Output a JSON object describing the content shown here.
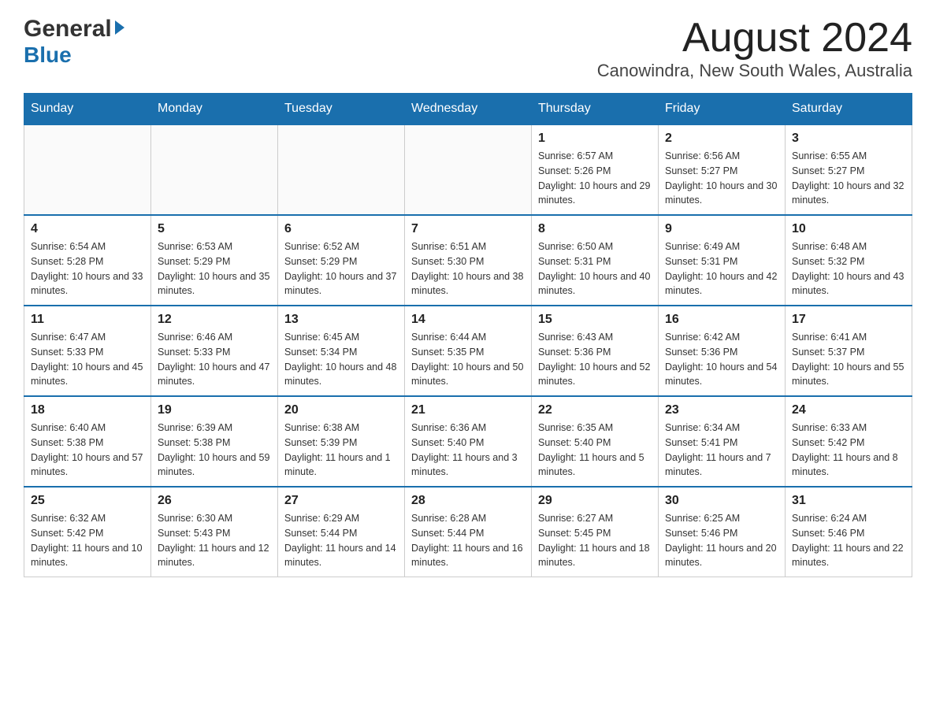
{
  "header": {
    "logo_general": "General",
    "logo_blue": "Blue",
    "month": "August 2024",
    "location": "Canowindra, New South Wales, Australia"
  },
  "days_of_week": [
    "Sunday",
    "Monday",
    "Tuesday",
    "Wednesday",
    "Thursday",
    "Friday",
    "Saturday"
  ],
  "weeks": [
    [
      {
        "day": "",
        "info": ""
      },
      {
        "day": "",
        "info": ""
      },
      {
        "day": "",
        "info": ""
      },
      {
        "day": "",
        "info": ""
      },
      {
        "day": "1",
        "info": "Sunrise: 6:57 AM\nSunset: 5:26 PM\nDaylight: 10 hours and 29 minutes."
      },
      {
        "day": "2",
        "info": "Sunrise: 6:56 AM\nSunset: 5:27 PM\nDaylight: 10 hours and 30 minutes."
      },
      {
        "day": "3",
        "info": "Sunrise: 6:55 AM\nSunset: 5:27 PM\nDaylight: 10 hours and 32 minutes."
      }
    ],
    [
      {
        "day": "4",
        "info": "Sunrise: 6:54 AM\nSunset: 5:28 PM\nDaylight: 10 hours and 33 minutes."
      },
      {
        "day": "5",
        "info": "Sunrise: 6:53 AM\nSunset: 5:29 PM\nDaylight: 10 hours and 35 minutes."
      },
      {
        "day": "6",
        "info": "Sunrise: 6:52 AM\nSunset: 5:29 PM\nDaylight: 10 hours and 37 minutes."
      },
      {
        "day": "7",
        "info": "Sunrise: 6:51 AM\nSunset: 5:30 PM\nDaylight: 10 hours and 38 minutes."
      },
      {
        "day": "8",
        "info": "Sunrise: 6:50 AM\nSunset: 5:31 PM\nDaylight: 10 hours and 40 minutes."
      },
      {
        "day": "9",
        "info": "Sunrise: 6:49 AM\nSunset: 5:31 PM\nDaylight: 10 hours and 42 minutes."
      },
      {
        "day": "10",
        "info": "Sunrise: 6:48 AM\nSunset: 5:32 PM\nDaylight: 10 hours and 43 minutes."
      }
    ],
    [
      {
        "day": "11",
        "info": "Sunrise: 6:47 AM\nSunset: 5:33 PM\nDaylight: 10 hours and 45 minutes."
      },
      {
        "day": "12",
        "info": "Sunrise: 6:46 AM\nSunset: 5:33 PM\nDaylight: 10 hours and 47 minutes."
      },
      {
        "day": "13",
        "info": "Sunrise: 6:45 AM\nSunset: 5:34 PM\nDaylight: 10 hours and 48 minutes."
      },
      {
        "day": "14",
        "info": "Sunrise: 6:44 AM\nSunset: 5:35 PM\nDaylight: 10 hours and 50 minutes."
      },
      {
        "day": "15",
        "info": "Sunrise: 6:43 AM\nSunset: 5:36 PM\nDaylight: 10 hours and 52 minutes."
      },
      {
        "day": "16",
        "info": "Sunrise: 6:42 AM\nSunset: 5:36 PM\nDaylight: 10 hours and 54 minutes."
      },
      {
        "day": "17",
        "info": "Sunrise: 6:41 AM\nSunset: 5:37 PM\nDaylight: 10 hours and 55 minutes."
      }
    ],
    [
      {
        "day": "18",
        "info": "Sunrise: 6:40 AM\nSunset: 5:38 PM\nDaylight: 10 hours and 57 minutes."
      },
      {
        "day": "19",
        "info": "Sunrise: 6:39 AM\nSunset: 5:38 PM\nDaylight: 10 hours and 59 minutes."
      },
      {
        "day": "20",
        "info": "Sunrise: 6:38 AM\nSunset: 5:39 PM\nDaylight: 11 hours and 1 minute."
      },
      {
        "day": "21",
        "info": "Sunrise: 6:36 AM\nSunset: 5:40 PM\nDaylight: 11 hours and 3 minutes."
      },
      {
        "day": "22",
        "info": "Sunrise: 6:35 AM\nSunset: 5:40 PM\nDaylight: 11 hours and 5 minutes."
      },
      {
        "day": "23",
        "info": "Sunrise: 6:34 AM\nSunset: 5:41 PM\nDaylight: 11 hours and 7 minutes."
      },
      {
        "day": "24",
        "info": "Sunrise: 6:33 AM\nSunset: 5:42 PM\nDaylight: 11 hours and 8 minutes."
      }
    ],
    [
      {
        "day": "25",
        "info": "Sunrise: 6:32 AM\nSunset: 5:42 PM\nDaylight: 11 hours and 10 minutes."
      },
      {
        "day": "26",
        "info": "Sunrise: 6:30 AM\nSunset: 5:43 PM\nDaylight: 11 hours and 12 minutes."
      },
      {
        "day": "27",
        "info": "Sunrise: 6:29 AM\nSunset: 5:44 PM\nDaylight: 11 hours and 14 minutes."
      },
      {
        "day": "28",
        "info": "Sunrise: 6:28 AM\nSunset: 5:44 PM\nDaylight: 11 hours and 16 minutes."
      },
      {
        "day": "29",
        "info": "Sunrise: 6:27 AM\nSunset: 5:45 PM\nDaylight: 11 hours and 18 minutes."
      },
      {
        "day": "30",
        "info": "Sunrise: 6:25 AM\nSunset: 5:46 PM\nDaylight: 11 hours and 20 minutes."
      },
      {
        "day": "31",
        "info": "Sunrise: 6:24 AM\nSunset: 5:46 PM\nDaylight: 11 hours and 22 minutes."
      }
    ]
  ]
}
